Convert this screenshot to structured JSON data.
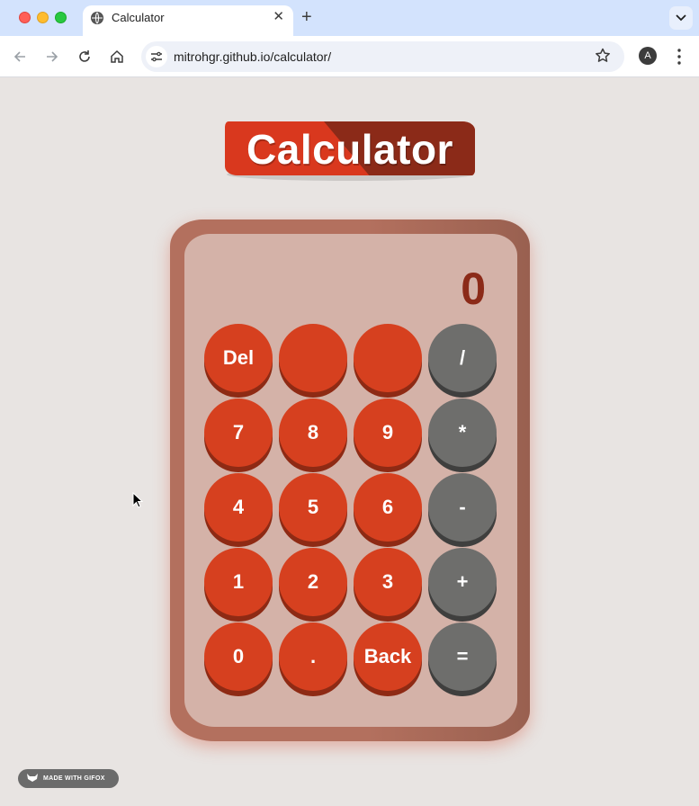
{
  "browser": {
    "tab_title": "Calculator",
    "url": "mitrohgr.github.io/calculator/",
    "profile_initial": "A"
  },
  "page": {
    "heading": "Calculator",
    "display_value": "0",
    "keys": [
      {
        "label": "Del",
        "variant": "red"
      },
      {
        "label": "",
        "variant": "red"
      },
      {
        "label": "",
        "variant": "red"
      },
      {
        "label": "/",
        "variant": "grey"
      },
      {
        "label": "7",
        "variant": "red"
      },
      {
        "label": "8",
        "variant": "red"
      },
      {
        "label": "9",
        "variant": "red"
      },
      {
        "label": "*",
        "variant": "grey"
      },
      {
        "label": "4",
        "variant": "red"
      },
      {
        "label": "5",
        "variant": "red"
      },
      {
        "label": "6",
        "variant": "red"
      },
      {
        "label": "-",
        "variant": "grey"
      },
      {
        "label": "1",
        "variant": "red"
      },
      {
        "label": "2",
        "variant": "red"
      },
      {
        "label": "3",
        "variant": "red"
      },
      {
        "label": "+",
        "variant": "grey"
      },
      {
        "label": "0",
        "variant": "red"
      },
      {
        "label": ".",
        "variant": "red"
      },
      {
        "label": "Back",
        "variant": "red"
      },
      {
        "label": "=",
        "variant": "grey"
      }
    ],
    "watermark": "MADE WITH GIFOX"
  },
  "colors": {
    "key_red": "#d6401f",
    "key_grey": "#6e6e6c",
    "display_text": "#8b2a18",
    "banner_red": "#d9381e"
  }
}
